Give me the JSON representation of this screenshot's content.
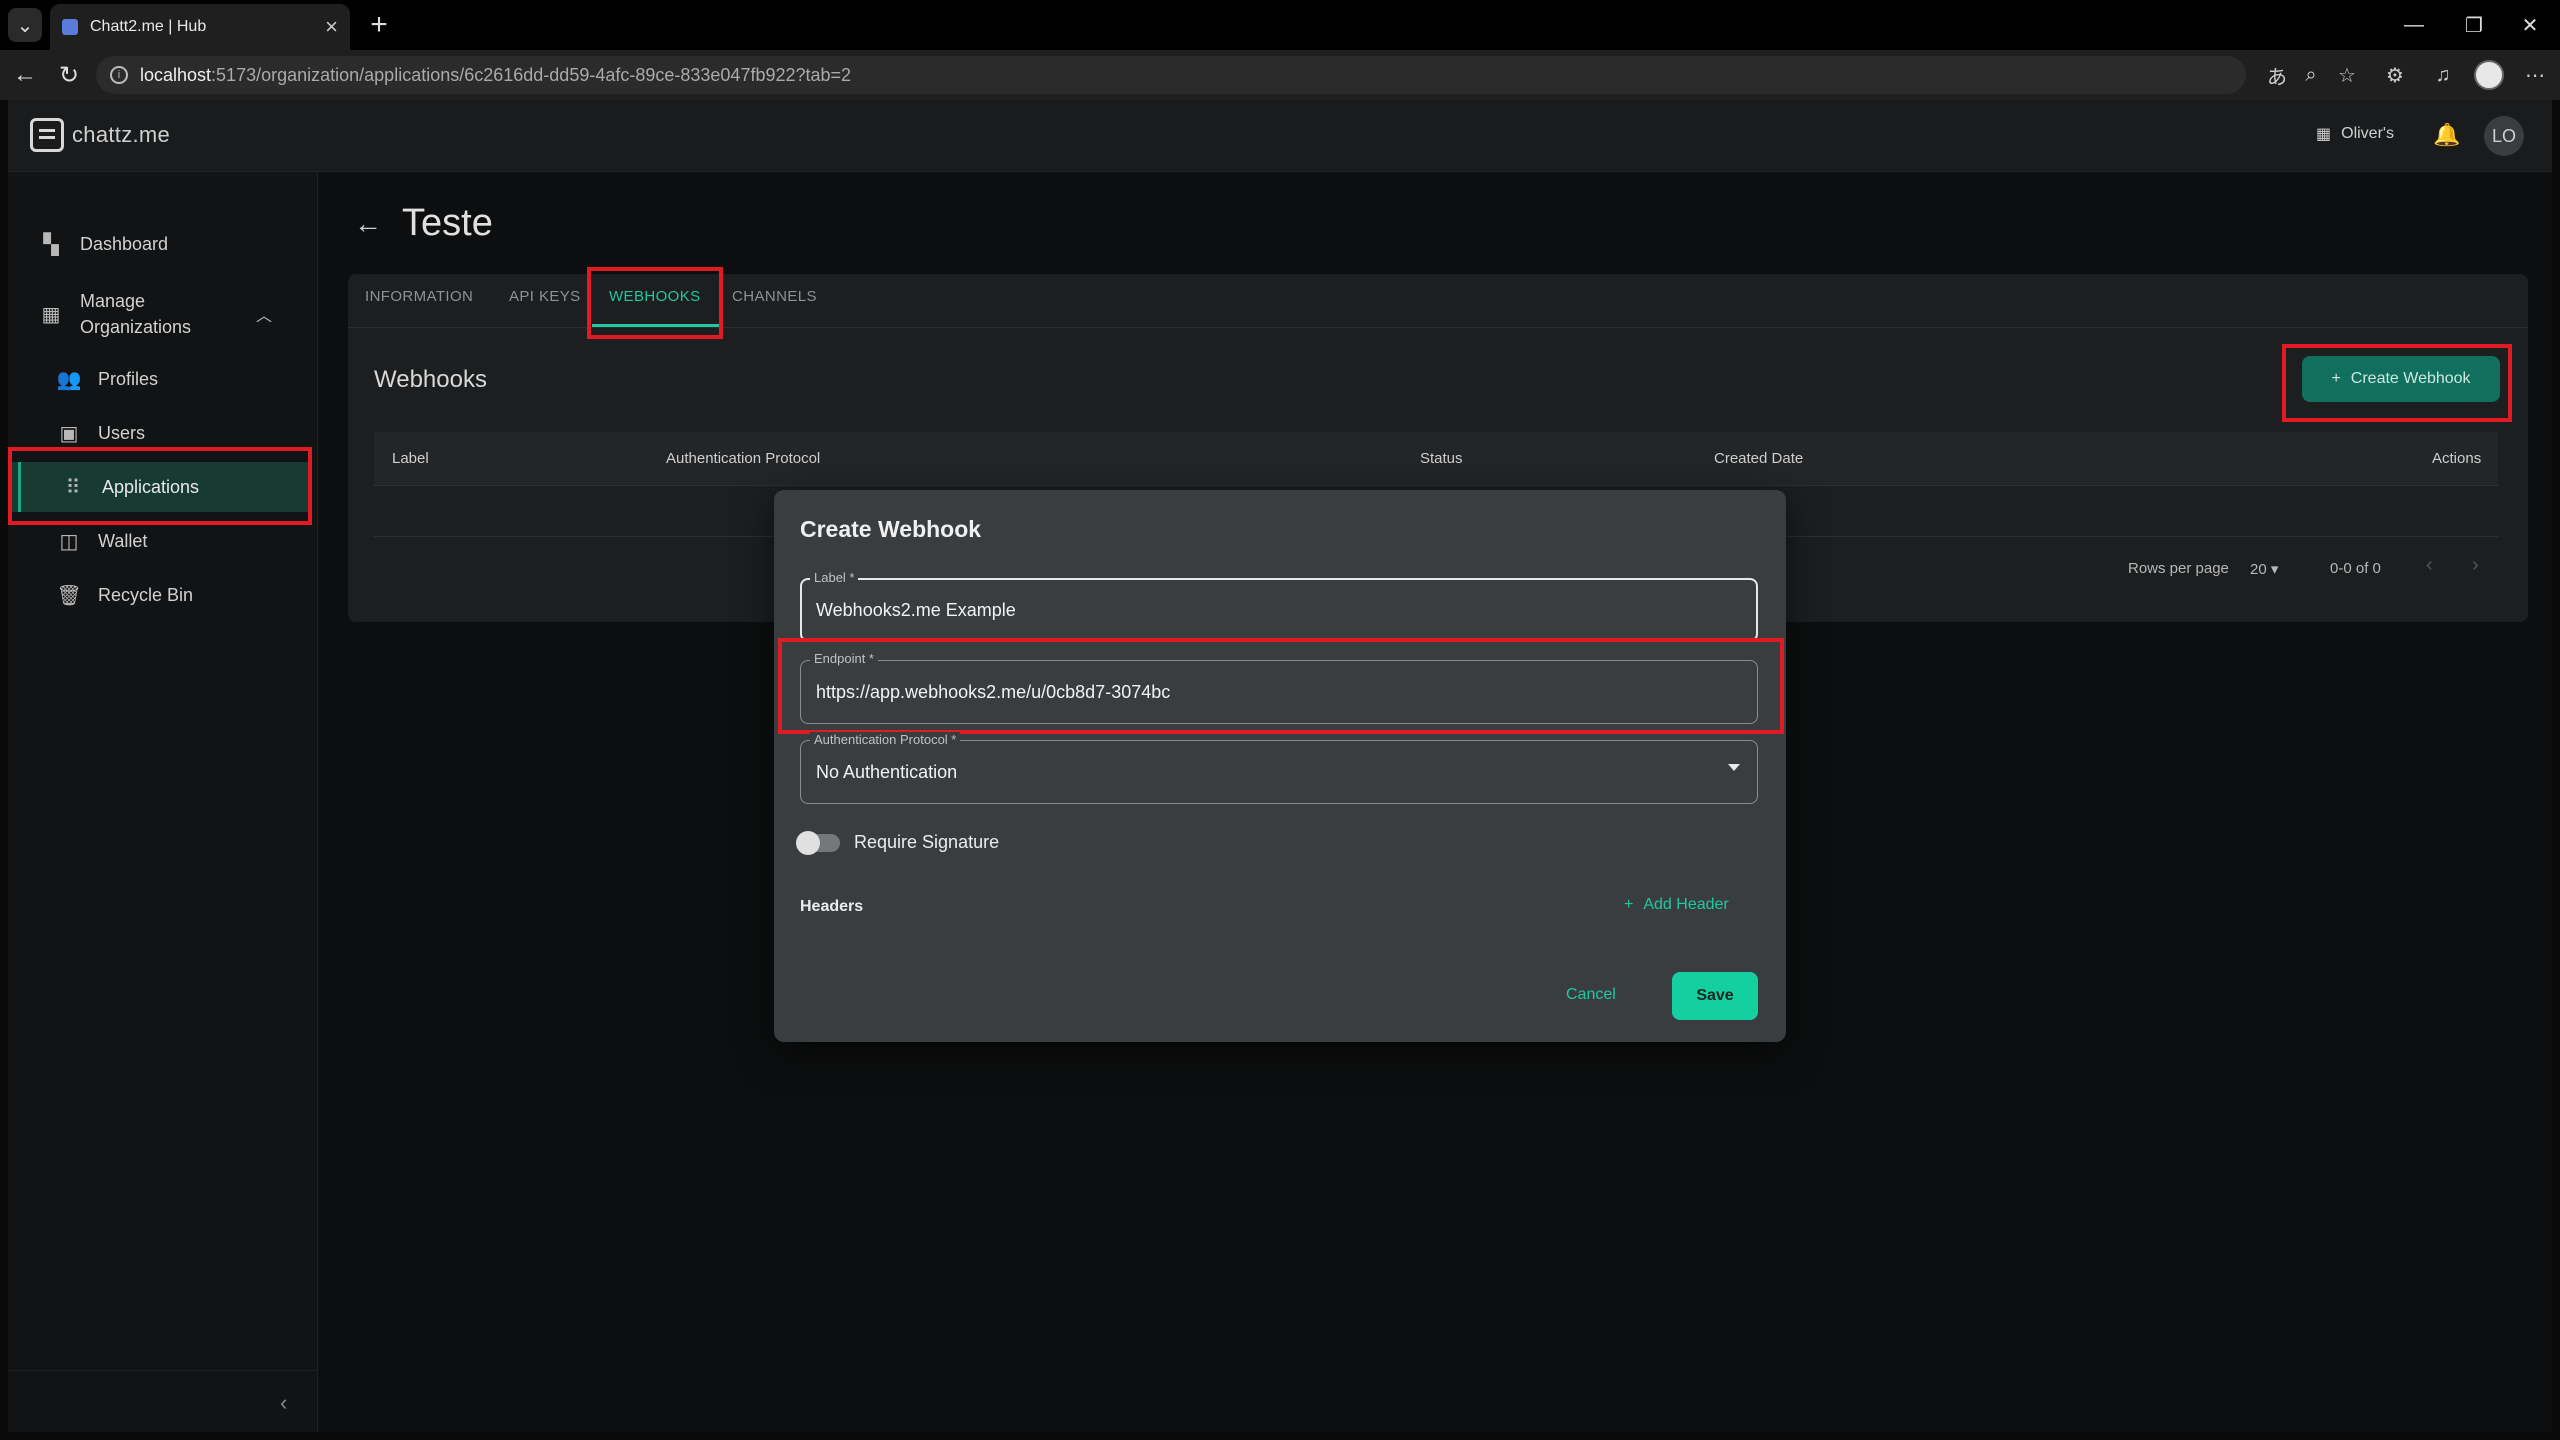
{
  "browser": {
    "tab_title": "Chatt2.me | Hub",
    "url_host": "localhost",
    "url_path": ":5173/organization/applications/6c2616dd-dd59-4afc-89ce-833e047fb922?tab=2"
  },
  "app": {
    "logo_text": "chattz.me",
    "org_name": "Oliver's",
    "avatar_initials": "LO"
  },
  "sidebar": {
    "items": [
      {
        "label": "Dashboard"
      },
      {
        "label": "Manage\nOrganizations"
      },
      {
        "label": "Profiles"
      },
      {
        "label": "Users"
      },
      {
        "label": "Applications"
      },
      {
        "label": "Wallet"
      },
      {
        "label": "Recycle Bin"
      }
    ]
  },
  "page": {
    "title": "Teste",
    "tabs": [
      "INFORMATION",
      "API KEYS",
      "WEBHOOKS",
      "CHANNELS"
    ],
    "section_title": "Webhooks",
    "create_button": "Create Webhook",
    "table": {
      "columns": [
        "Label",
        "Authentication Protocol",
        "Status",
        "Created Date",
        "Actions"
      ]
    },
    "pagination": {
      "rows_label": "Rows per page",
      "rows_value": "20",
      "range": "0-0 of 0"
    }
  },
  "dialog": {
    "title": "Create Webhook",
    "label_field": {
      "label": "Label *",
      "value": "Webhooks2.me Example"
    },
    "endpoint_field": {
      "label": "Endpoint *",
      "value": "https://app.webhooks2.me/u/0cb8d7-3074bc"
    },
    "auth_field": {
      "label": "Authentication Protocol *",
      "value": "No Authentication"
    },
    "signature_label": "Require Signature",
    "signature_on": false,
    "headers_label": "Headers",
    "add_header": "Add Header",
    "cancel": "Cancel",
    "save": "Save"
  },
  "colors": {
    "accent": "#1ec9a0",
    "highlight": "#e01b24"
  }
}
